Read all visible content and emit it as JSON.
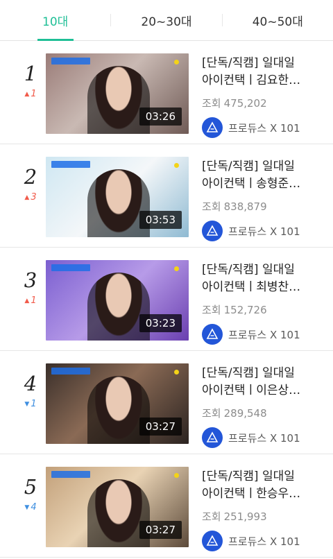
{
  "tabs": [
    {
      "label": "10대",
      "active": true
    },
    {
      "label": "20~30대",
      "active": false
    },
    {
      "label": "40~50대",
      "active": false
    }
  ],
  "videos": [
    {
      "rank": "1",
      "change_dir": "up",
      "change": "1",
      "title_line1": "[단독/직캠] 일대일",
      "title_line2": "아이컨택ㅣ김요한…",
      "views_label": "조회",
      "views": "475,202",
      "duration": "03:26",
      "channel": "프로듀스 X 101",
      "thumb_bg": "bg1"
    },
    {
      "rank": "2",
      "change_dir": "up",
      "change": "3",
      "title_line1": "[단독/직캠] 일대일",
      "title_line2": "아이컨택ㅣ송형준…",
      "views_label": "조회",
      "views": "838,879",
      "duration": "03:53",
      "channel": "프로듀스 X 101",
      "thumb_bg": "bg2"
    },
    {
      "rank": "3",
      "change_dir": "up",
      "change": "1",
      "title_line1": "[단독/직캠] 일대일",
      "title_line2": "아이컨택ㅣ최병찬…",
      "views_label": "조회",
      "views": "152,726",
      "duration": "03:23",
      "channel": "프로듀스 X 101",
      "thumb_bg": "bg3"
    },
    {
      "rank": "4",
      "change_dir": "down",
      "change": "1",
      "title_line1": "[단독/직캠] 일대일",
      "title_line2": "아이컨택ㅣ이은상…",
      "views_label": "조회",
      "views": "289,548",
      "duration": "03:27",
      "channel": "프로듀스 X 101",
      "thumb_bg": "bg4"
    },
    {
      "rank": "5",
      "change_dir": "down",
      "change": "4",
      "title_line1": "[단독/직캠] 일대일",
      "title_line2": "아이컨택ㅣ한승우…",
      "views_label": "조회",
      "views": "251,993",
      "duration": "03:27",
      "channel": "프로듀스 X 101",
      "thumb_bg": "bg5"
    }
  ],
  "colors": {
    "accent": "#1fbf96",
    "rank_up": "#f15a4a",
    "rank_down": "#3f8fe0",
    "channel_icon": "#2356d8"
  }
}
